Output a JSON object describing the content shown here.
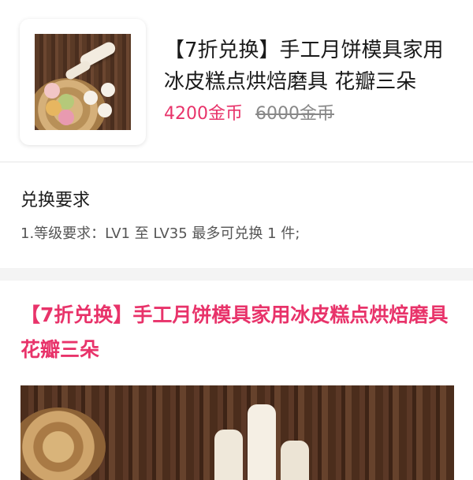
{
  "product": {
    "title": "【7折兑换】手工月饼模具家用冰皮糕点烘焙磨具 花瓣三朵",
    "price": "4200金币",
    "original_price": "6000金币",
    "thumbnail_icon": "mooncake-mold-product-photo"
  },
  "requirements": {
    "heading": "兑换要求",
    "text": "1.等级要求：LV1 至 LV35 最多可兑换 1 件;"
  },
  "detail": {
    "title": "【7折兑换】手工月饼模具家用冰皮糕点烘焙磨具 花瓣三朵",
    "image_icon": "mooncake-mold-detail-photo"
  },
  "colors": {
    "accent": "#e8336a",
    "divider": "#e6e6e6",
    "band": "#f4f4f4"
  }
}
